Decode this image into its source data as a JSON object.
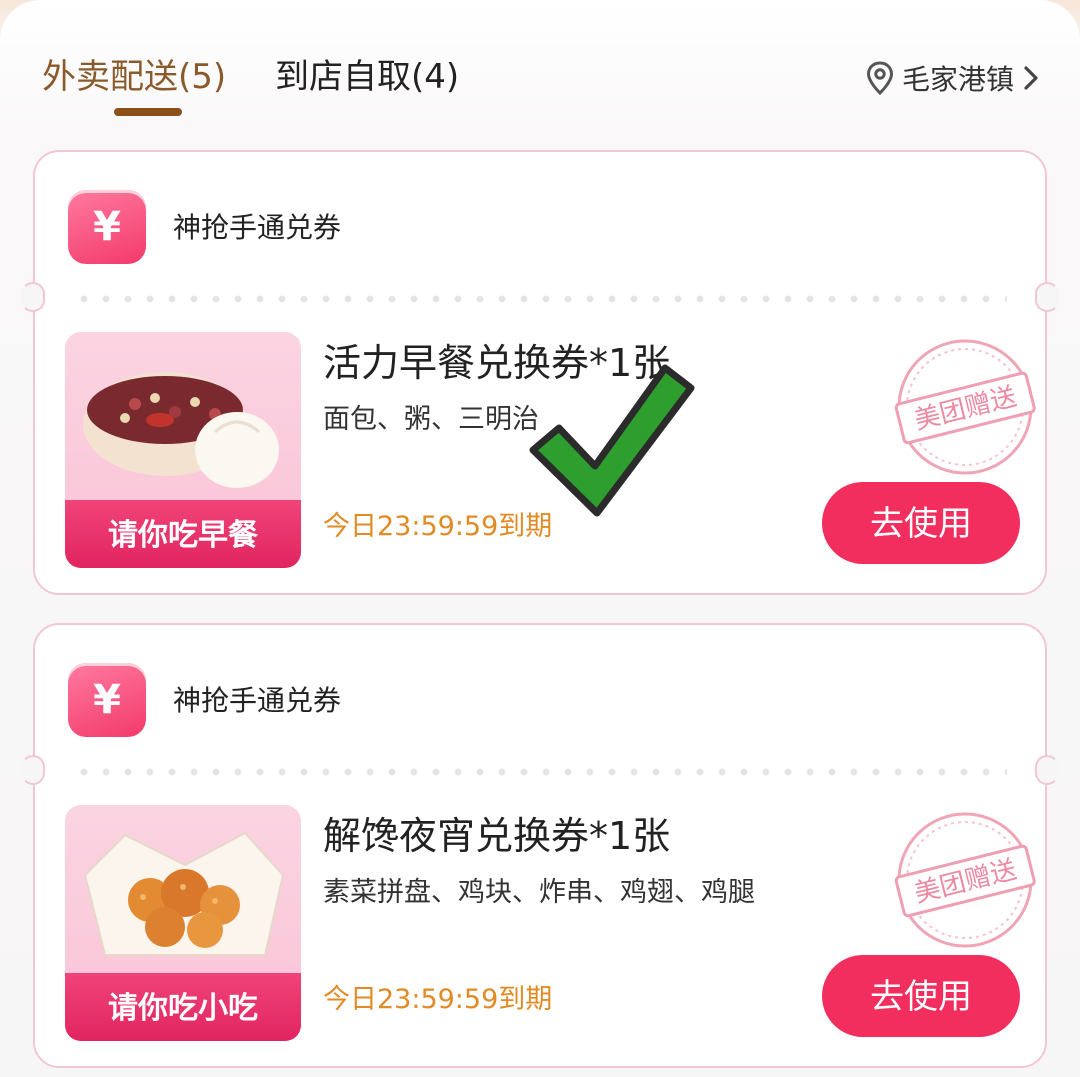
{
  "tabs": [
    {
      "label": "外卖配送(5)",
      "active": true
    },
    {
      "label": "到店自取(4)",
      "active": false
    }
  ],
  "location": {
    "label": "毛家港镇",
    "icon": "location-pin-icon"
  },
  "coupons": [
    {
      "type_label": "神抢手通兑券",
      "type_icon": "yen-icon",
      "title": "活力早餐兑换券*1张",
      "subtitle": "面包、粥、三明治",
      "image_banner": "请你吃早餐",
      "expiry": "今日23:59:59到期",
      "button": "去使用",
      "stamp_text": "美团赠送"
    },
    {
      "type_label": "神抢手通兑券",
      "type_icon": "yen-icon",
      "title": "解馋夜宵兑换券*1张",
      "subtitle": "素菜拼盘、鸡块、炸串、鸡翅、鸡腿",
      "image_banner": "请你吃小吃",
      "expiry": "今日23:59:59到期",
      "button": "去使用",
      "stamp_text": "美团赠送"
    }
  ],
  "colors": {
    "accent_tab": "#8b5a2b",
    "button": "#f12e5e",
    "expiry": "#e28a24",
    "checkmark": "#2e9e2e"
  }
}
